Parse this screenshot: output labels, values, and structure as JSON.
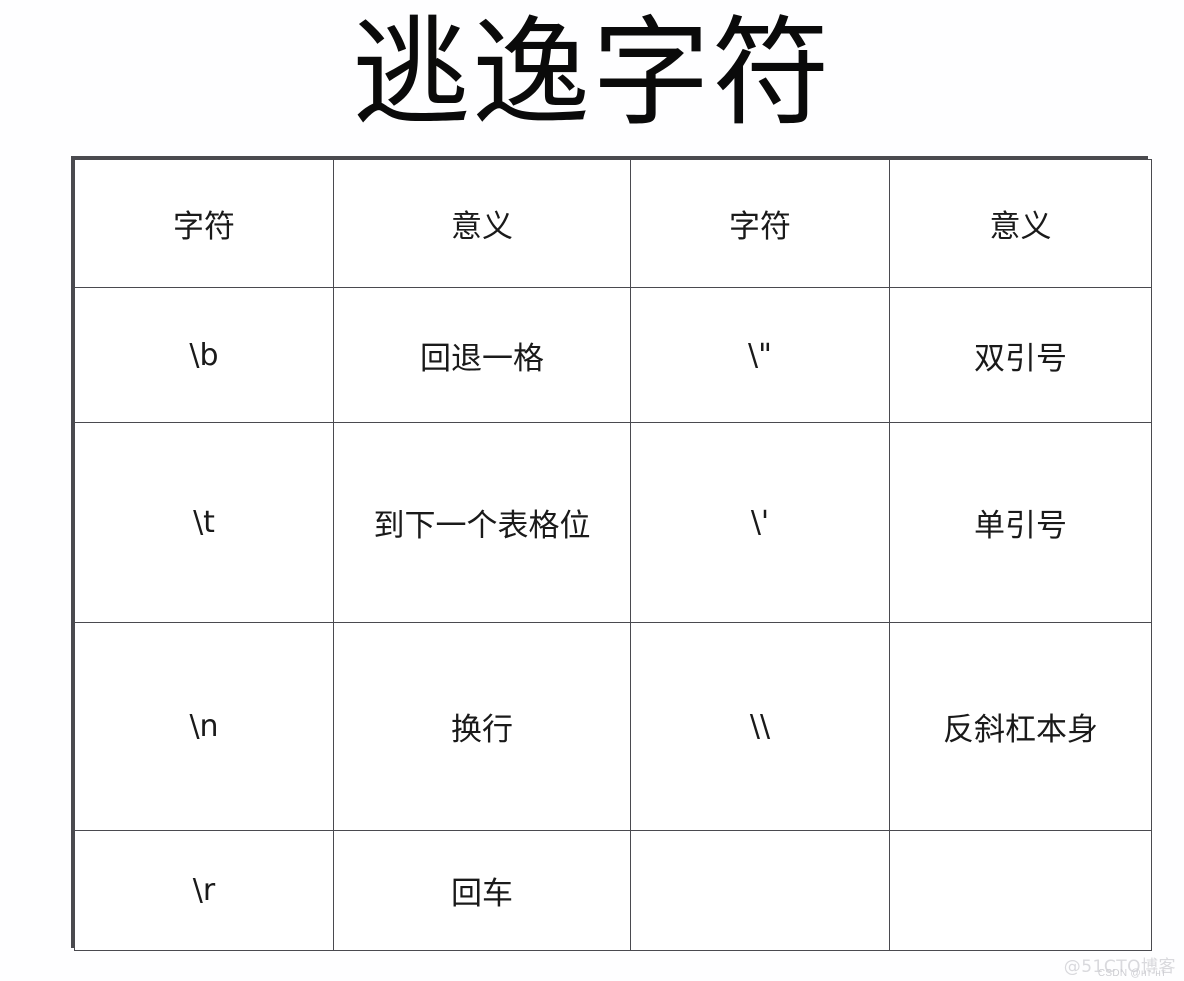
{
  "document": {
    "title": "逃逸字符"
  },
  "table": {
    "headers": [
      "字符",
      "意义",
      "字符",
      "意义"
    ],
    "rows": [
      {
        "char_left": "\\b",
        "meaning_left": "回退一格",
        "char_right": "\\\"",
        "meaning_right": "双引号"
      },
      {
        "char_left": "\\t",
        "meaning_left": "到下一个表格位",
        "char_right": "\\'",
        "meaning_right": "单引号"
      },
      {
        "char_left": "\\n",
        "meaning_left": "换行",
        "char_right": "\\\\",
        "meaning_right": "反斜杠本身"
      },
      {
        "char_left": "\\r",
        "meaning_left": "回车",
        "char_right": "",
        "meaning_right": ""
      }
    ]
  },
  "watermarks": {
    "primary": "@51CTO博客",
    "secondary": "CSDN @нт-нт"
  },
  "colors": {
    "border": "#4a4a4f",
    "text": "#1a1a1a",
    "background": "#fefeff",
    "watermark": "#d9d9dd"
  }
}
